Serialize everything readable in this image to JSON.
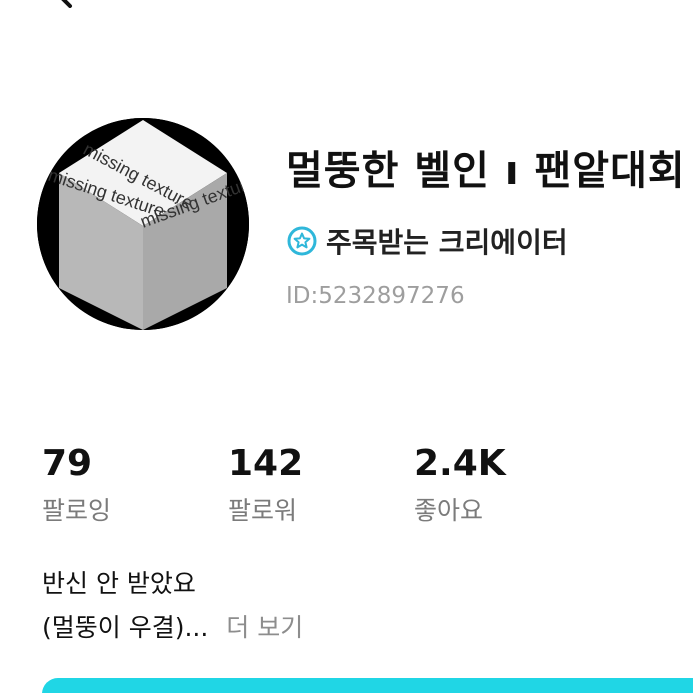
{
  "profile": {
    "name": "멀뚱한 벨인 ı 팬앝대회",
    "badge_label": "주목받는 크리에이터",
    "user_id": "ID:5232897276",
    "avatar_text": "missing texture"
  },
  "stats": [
    {
      "value": "79",
      "label": "팔로잉"
    },
    {
      "value": "142",
      "label": "팔로워"
    },
    {
      "value": "2.4K",
      "label": "좋아요"
    }
  ],
  "bio": {
    "line1": "반신 안 받았요",
    "line2": "(멀뚱이 우결)...",
    "more_label": "더 보기"
  },
  "colors": {
    "accent": "#20d6e5",
    "badge": "#2fb7da",
    "muted": "#9e9e9e"
  },
  "icons": {
    "back": "chevron-left-icon",
    "badge": "star-badge-icon"
  }
}
